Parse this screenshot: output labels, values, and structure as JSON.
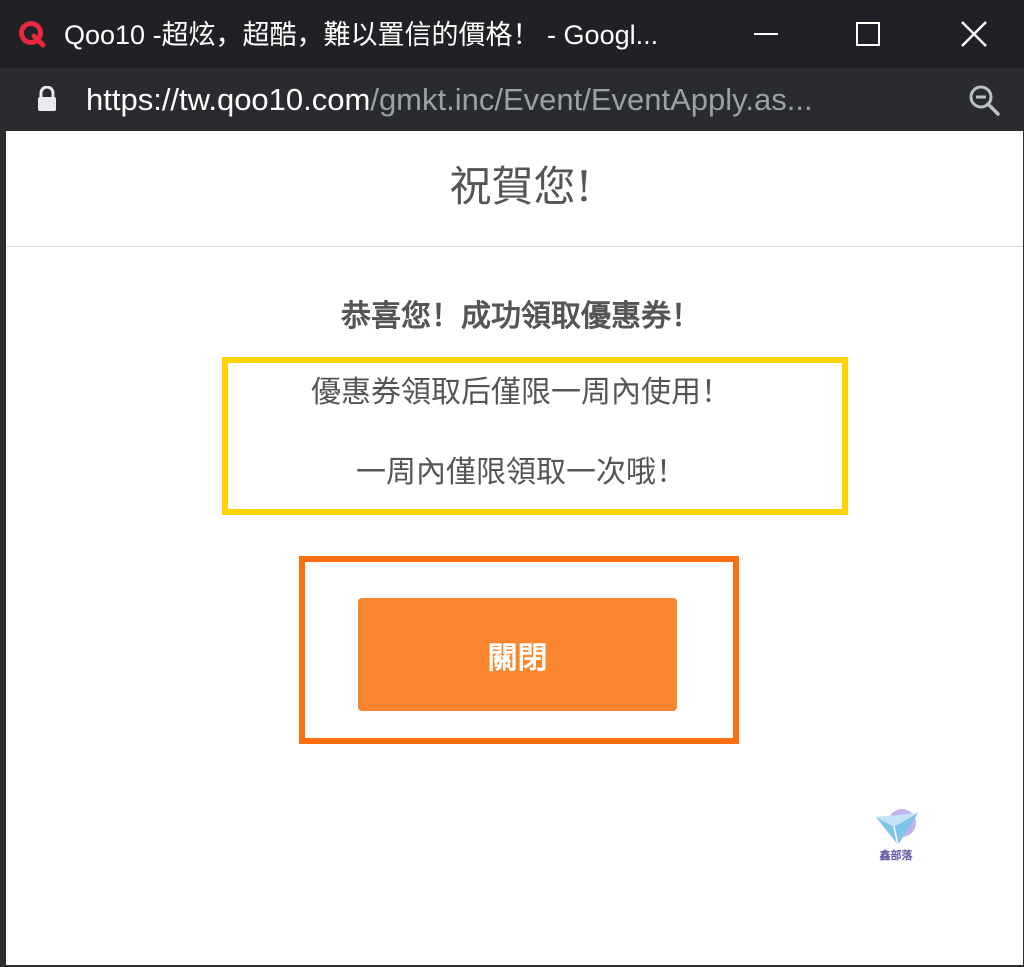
{
  "window": {
    "title": "Qoo10 -超炫，超酷，難以置信的價格！ - Googl...",
    "app_icon": "qoo10-logo-icon",
    "controls": [
      "minimize-icon",
      "maximize-icon",
      "close-icon"
    ]
  },
  "addressbar": {
    "url_host": "https://tw.qoo10.com",
    "url_path": "/gmkt.inc/Event/EventApply.as...",
    "lock_icon": "lock-icon",
    "zoom_icon": "zoom-out-icon"
  },
  "modal": {
    "title": "祝賀您!",
    "message_main": "恭喜您！成功領取優惠券！",
    "message_line1": "優惠券領取后僅限一周內使用！",
    "message_line2": "一周內僅限領取一次哦！",
    "close_button_label": "關閉"
  },
  "watermark": {
    "text": "鑫部落"
  },
  "colors": {
    "titlebar": "#202124",
    "addressbar": "#292b2e",
    "highlight_yellow": "#ffd200",
    "highlight_orange": "#ff6f0f",
    "button": "#fa862f",
    "text": "#555555",
    "qoo10_red": "#e8283c"
  }
}
